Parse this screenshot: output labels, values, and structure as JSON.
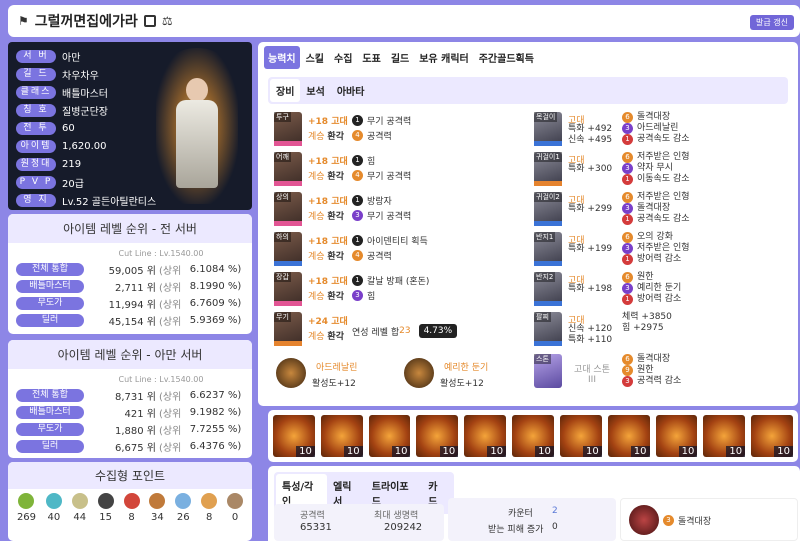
{
  "header": {
    "title": "그럴꺼면집에가라",
    "update_btn": "발급 갱신"
  },
  "profile": {
    "rows": [
      {
        "label": "서 버",
        "value": "아만"
      },
      {
        "label": "길 드",
        "value": "차우차우"
      },
      {
        "label": "클래스",
        "value": "배틀마스터"
      },
      {
        "label": "칭 호",
        "value": "질병군단장"
      },
      {
        "label": "전 투",
        "value": "60"
      },
      {
        "label": "아이템",
        "value": "1,620.00"
      },
      {
        "label": "원정대",
        "value": "219"
      },
      {
        "label": "P V P",
        "value": "20급"
      },
      {
        "label": "영 지",
        "value": "Lv.52 골든아틸란티스"
      }
    ]
  },
  "rank_all": {
    "title": "아이템 레벨 순위 - 전 서버",
    "cut": "Cut Line : Lv.1540.00",
    "rows": [
      {
        "label": "전체 통합",
        "num": "59,005 위",
        "s": "(상위",
        "pct": "6.1084 %)"
      },
      {
        "label": "배틀마스터",
        "num": "2,711 위",
        "s": "(상위",
        "pct": "8.1990 %)"
      },
      {
        "label": "무도가",
        "num": "11,994 위",
        "s": "(상위",
        "pct": "6.7609 %)"
      },
      {
        "label": "딜러",
        "num": "45,154 위",
        "s": "(상위",
        "pct": "5.9369 %)"
      }
    ]
  },
  "rank_server": {
    "title": "아이템 레벨 순위 - 아만 서버",
    "cut": "Cut Line : Lv.1540.00",
    "rows": [
      {
        "label": "전체 통합",
        "num": "8,731 위",
        "s": "(상위",
        "pct": "6.6237 %)"
      },
      {
        "label": "배틀마스터",
        "num": "421 위",
        "s": "(상위",
        "pct": "9.1982 %)"
      },
      {
        "label": "무도가",
        "num": "1,880 위",
        "s": "(상위",
        "pct": "7.7255 %)"
      },
      {
        "label": "딜러",
        "num": "6,675 위",
        "s": "(상위",
        "pct": "6.4376 %)"
      }
    ]
  },
  "collection": {
    "title": "수집형 포인트",
    "items": [
      "269",
      "40",
      "44",
      "15",
      "8",
      "34",
      "26",
      "8",
      "0"
    ],
    "colors": [
      "#7fb43a",
      "#4fb8c6",
      "#c8c08a",
      "#444",
      "#d2463a",
      "#c07a3a",
      "#7ab0e0",
      "#e0a050",
      "#aa8866"
    ]
  },
  "tabs": [
    "능력치",
    "스킬",
    "수집",
    "도표",
    "길드",
    "보유 캐릭터",
    "주간골드획득"
  ],
  "subtabs": [
    "장비",
    "보석",
    "아바타"
  ],
  "equip": [
    {
      "tag": "투구",
      "bar": "pink",
      "l1": "+18 고대",
      "l2": "계승",
      "l2b": "환각",
      "e": [
        {
          "n": "1",
          "c": "black",
          "t": "무기 공격력"
        },
        {
          "n": "4",
          "c": "orange",
          "t": "공격력"
        }
      ]
    },
    {
      "tag": "어깨",
      "bar": "pink",
      "l1": "+18 고대",
      "l2": "계승",
      "l2b": "환각",
      "e": [
        {
          "n": "1",
          "c": "black",
          "t": "힘"
        },
        {
          "n": "4",
          "c": "orange",
          "t": "무기 공격력"
        }
      ]
    },
    {
      "tag": "상의",
      "bar": "pink",
      "l1": "+18 고대",
      "l2": "계승",
      "l2b": "환각",
      "e": [
        {
          "n": "1",
          "c": "black",
          "t": "방랑자"
        },
        {
          "n": "3",
          "c": "purple",
          "t": "무기 공격력"
        }
      ]
    },
    {
      "tag": "하의",
      "bar": "blue",
      "l1": "+18 고대",
      "l2": "계승",
      "l2b": "환각",
      "e": [
        {
          "n": "1",
          "c": "black",
          "t": "아이덴티티 획득"
        },
        {
          "n": "4",
          "c": "orange",
          "t": "공격력"
        }
      ]
    },
    {
      "tag": "장갑",
      "bar": "pink",
      "l1": "+18 고대",
      "l2": "계승",
      "l2b": "환각",
      "e": [
        {
          "n": "1",
          "c": "black",
          "t": "칼날 방패 (혼돈)"
        },
        {
          "n": "3",
          "c": "purple",
          "t": "힘"
        }
      ]
    },
    {
      "tag": "무기",
      "bar": "orange",
      "l1": "+24 고대",
      "l2": "계승",
      "l2b": "환각",
      "extra": "연성 레벨 합",
      "extra_n": "23",
      "pct": "4.73%"
    }
  ],
  "acc": [
    {
      "tag": "목걸이",
      "bar": "blue",
      "grade": "고대",
      "s1": "특화 +492",
      "s2": "신속 +495",
      "e": [
        {
          "n": "6",
          "c": "orange",
          "t": "돌격대장"
        },
        {
          "n": "3",
          "c": "purple",
          "t": "아드레날린"
        },
        {
          "n": "1",
          "c": "red",
          "t": "공격속도 감소"
        }
      ]
    },
    {
      "tag": "귀걸이1",
      "bar": "orange",
      "grade": "고대",
      "s1": "특화 +300",
      "s2": "",
      "e": [
        {
          "n": "6",
          "c": "orange",
          "t": "저주받은 인형"
        },
        {
          "n": "3",
          "c": "purple",
          "t": "약자 무시"
        },
        {
          "n": "1",
          "c": "red",
          "t": "이동속도 감소"
        }
      ]
    },
    {
      "tag": "귀걸이2",
      "bar": "blue",
      "grade": "고대",
      "s1": "특화 +299",
      "s2": "",
      "e": [
        {
          "n": "6",
          "c": "orange",
          "t": "저주받은 인형"
        },
        {
          "n": "3",
          "c": "purple",
          "t": "돌격대장"
        },
        {
          "n": "1",
          "c": "red",
          "t": "공격속도 감소"
        }
      ]
    },
    {
      "tag": "반지1",
      "bar": "blue",
      "grade": "고대",
      "s1": "특화 +199",
      "s2": "",
      "e": [
        {
          "n": "6",
          "c": "orange",
          "t": "오의 강화"
        },
        {
          "n": "3",
          "c": "purple",
          "t": "저주받은 인형"
        },
        {
          "n": "1",
          "c": "red",
          "t": "방어력 감소"
        }
      ]
    },
    {
      "tag": "반지2",
      "bar": "blue",
      "grade": "고대",
      "s1": "특화 +198",
      "s2": "",
      "e": [
        {
          "n": "6",
          "c": "orange",
          "t": "원한"
        },
        {
          "n": "3",
          "c": "purple",
          "t": "예리한 둔기"
        },
        {
          "n": "1",
          "c": "red",
          "t": "방어력 감소"
        }
      ]
    },
    {
      "tag": "팔찌",
      "bar": "blue",
      "grade": "고대",
      "s1": "신속 +120",
      "s2": "특화 +110",
      "stats": [
        "체력 +3850",
        "힘 +2975"
      ]
    }
  ],
  "engraving": [
    {
      "name": "아드레날린",
      "lvl": "활성도+12"
    },
    {
      "name": "예리한 둔기",
      "lvl": "활성도+12"
    }
  ],
  "stone": {
    "name": "고대 스톤 III",
    "tag": "스톤",
    "e": [
      {
        "n": "6",
        "c": "orange",
        "t": "돌격대장"
      },
      {
        "n": "9",
        "c": "orange",
        "t": "원한"
      },
      {
        "n": "3",
        "c": "red",
        "t": "공격력 감소"
      }
    ]
  },
  "gems": [
    "10",
    "10",
    "10",
    "10",
    "10",
    "10",
    "10",
    "10",
    "10",
    "10",
    "10"
  ],
  "bottom_tabs": [
    "특성/각인",
    "엘릭서",
    "트라이포드",
    "카드"
  ],
  "bottom_stats": {
    "atk_label": "공격력",
    "atk": "65331",
    "hp_label": "최대 생명력",
    "hp": "209242",
    "counter_label": "카운터",
    "counter": "2",
    "dmgdown_label": "받는 피해 증가",
    "dmgdown": "0",
    "eng_n": "3",
    "eng_t": "돌격대장"
  }
}
